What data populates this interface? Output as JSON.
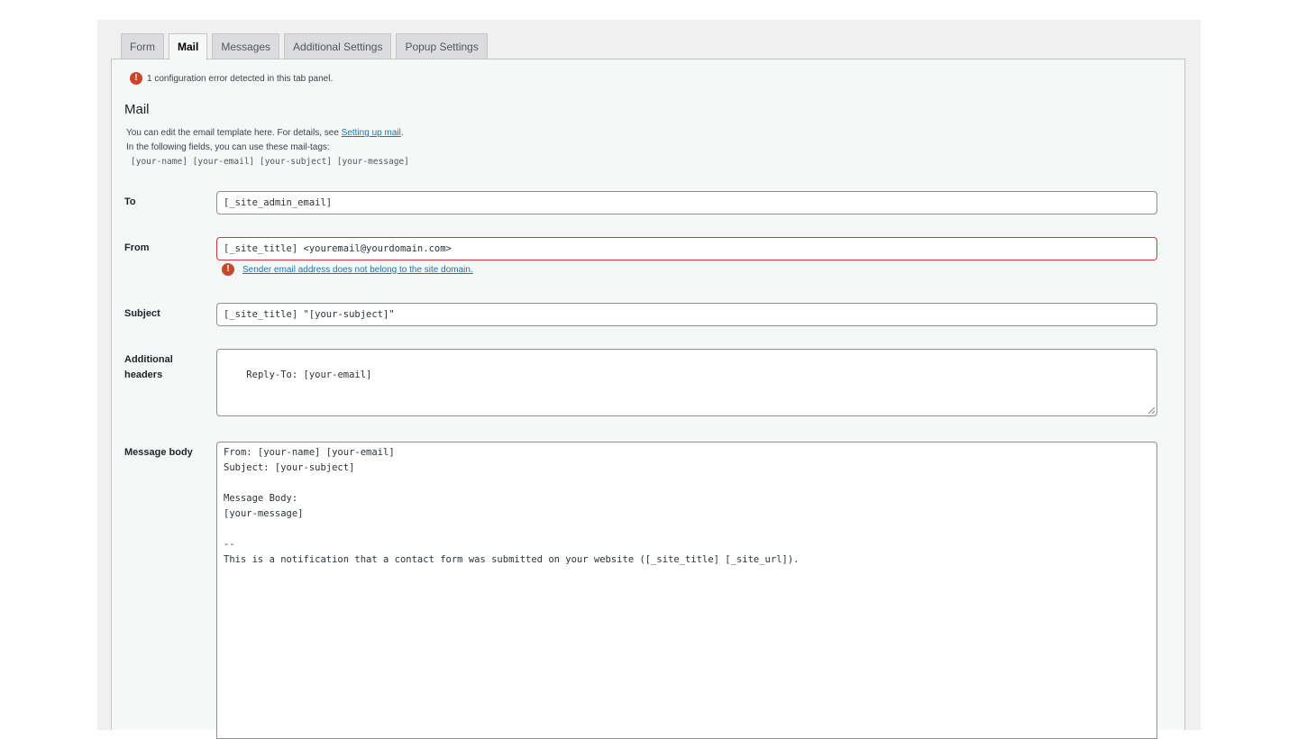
{
  "tabs": [
    {
      "label": "Form",
      "active": false
    },
    {
      "label": "Mail",
      "active": true
    },
    {
      "label": "Messages",
      "active": false
    },
    {
      "label": "Additional Settings",
      "active": false
    },
    {
      "label": "Popup Settings",
      "active": false
    }
  ],
  "config_error": {
    "icon": "!",
    "text": "1 configuration error detected in this tab panel."
  },
  "section": {
    "title": "Mail",
    "desc_prefix": "You can edit the email template here. For details, see ",
    "desc_link": "Setting up mail",
    "desc_suffix": ".",
    "desc_line2": "In the following fields, you can use these mail-tags:",
    "mail_tags": "[your-name] [your-email] [your-subject] [your-message]"
  },
  "fields": {
    "to": {
      "label": "To",
      "value": "[_site_admin_email]"
    },
    "from": {
      "label": "From",
      "value": "[_site_title] <youremail@yourdomain.com>",
      "error_icon": "!",
      "error": "Sender email address does not belong to the site domain."
    },
    "subject": {
      "label": "Subject",
      "value": "[_site_title] \"[your-subject]\""
    },
    "additional_headers": {
      "label": "Additional headers",
      "value": "Reply-To: [your-email]"
    },
    "message_body": {
      "label": "Message body",
      "value": "From: [your-name] [your-email]\nSubject: [your-subject]\n\nMessage Body:\n[your-message]\n\n-- \nThis is a notification that a contact form was submitted on your website ([_site_title] [_site_url])."
    }
  },
  "colors": {
    "error": "#c9482c",
    "link": "#2271b1",
    "error_border": "#d63638"
  }
}
